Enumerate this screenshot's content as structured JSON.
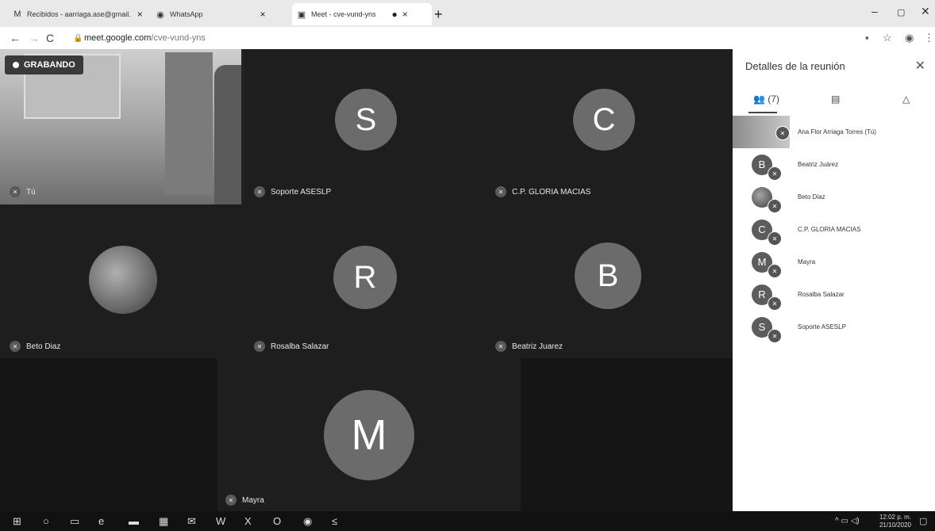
{
  "browser": {
    "tabs": [
      {
        "icon": "M",
        "title": "Recibidos - aarriaga.ase@gmail.",
        "close": "×"
      },
      {
        "icon": "◉",
        "title": "WhatsApp",
        "close": "×"
      },
      {
        "icon": "▣",
        "title": "Meet - cve-vund-yns",
        "close": "×"
      }
    ],
    "new_tab": "+",
    "url_host": "meet.google.com",
    "url_path": "/cve-vund-yns"
  },
  "meet": {
    "recording_label": "GRABANDO",
    "tiles": [
      {
        "name": "Tú",
        "initial": ""
      },
      {
        "name": "Soporte ASESLP",
        "initial": "S"
      },
      {
        "name": "C.P. GLORIA MACIAS",
        "initial": "C"
      },
      {
        "name": "Beto Diaz",
        "initial": ""
      },
      {
        "name": "Rosalba Salazar",
        "initial": "R"
      },
      {
        "name": "Beatriz Juarez",
        "initial": "B"
      },
      {
        "name": "Mayra",
        "initial": "M"
      }
    ]
  },
  "panel": {
    "title": "Detalles de la reunión",
    "people_count": "(7)",
    "participants": [
      {
        "initial": "",
        "name": "Ana Flor Arriaga Torres (Tú)"
      },
      {
        "initial": "B",
        "name": "Beatriz Juárez"
      },
      {
        "initial": "",
        "name": "Beto Diaz"
      },
      {
        "initial": "C",
        "name": "C.P. GLORIA MACIAS"
      },
      {
        "initial": "M",
        "name": "Mayra"
      },
      {
        "initial": "R",
        "name": "Rosalba Salazar"
      },
      {
        "initial": "S",
        "name": "Soporte ASESLP"
      }
    ]
  },
  "taskbar": {
    "time": "12:02 p. m.",
    "date": "21/10/2020"
  },
  "colors": {
    "avatar": "#6b6b6b",
    "stage": "#202124",
    "panel": "#ffffff"
  }
}
